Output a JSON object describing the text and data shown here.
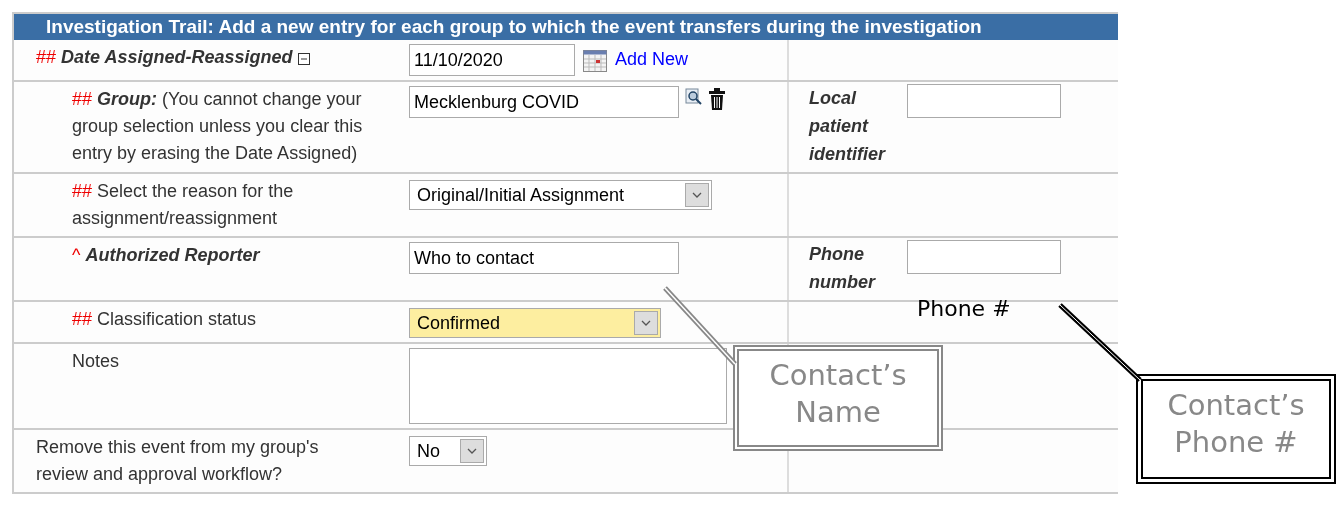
{
  "header": {
    "title": "Investigation Trail: Add a new entry for each group to which the event transfers during the investigation"
  },
  "rows": [
    {
      "marker": "##",
      "label": "Date Assigned-Reassigned",
      "emphasized": true,
      "expanded": true,
      "field": {
        "kind": "date",
        "value": "11/10/2020",
        "link": "Add New"
      },
      "children": [
        {
          "marker": "##",
          "label": "Group:",
          "note": "(You cannot change your group selection unless you clear this entry by erasing the Date Assigned)",
          "emphasized": true,
          "field": {
            "kind": "lookup",
            "value": "Mecklenburg COVID"
          },
          "side": {
            "label": "Local patient identifier"
          }
        },
        {
          "marker": "##",
          "label": "Select the reason for the assignment/reassignment",
          "emphasized": false,
          "field": {
            "kind": "select",
            "value": "Original/Initial Assignment",
            "highlighted": false
          }
        },
        {
          "marker": "^",
          "label": "Authorized Reporter",
          "emphasized": true,
          "field": {
            "kind": "text",
            "value": "Who to contact"
          },
          "side": {
            "label": "Phone number"
          }
        },
        {
          "marker": "##",
          "label": "Classification status",
          "emphasized": false,
          "field": {
            "kind": "select",
            "value": "Confirmed",
            "highlighted": true
          }
        },
        {
          "label": "Notes",
          "emphasized": false,
          "field": {
            "kind": "textarea"
          }
        }
      ]
    },
    {
      "label": "Remove this event from my group's review and approval workflow?",
      "emphasized": false,
      "field": {
        "kind": "select",
        "value": "No",
        "highlighted": false
      }
    }
  ],
  "annotations": [
    {
      "kind": "label",
      "text": "Phone #"
    },
    {
      "kind": "callout-light",
      "text": "Contact’s Name"
    },
    {
      "kind": "callout-dark",
      "text": "Contact’s Phone #"
    }
  ]
}
